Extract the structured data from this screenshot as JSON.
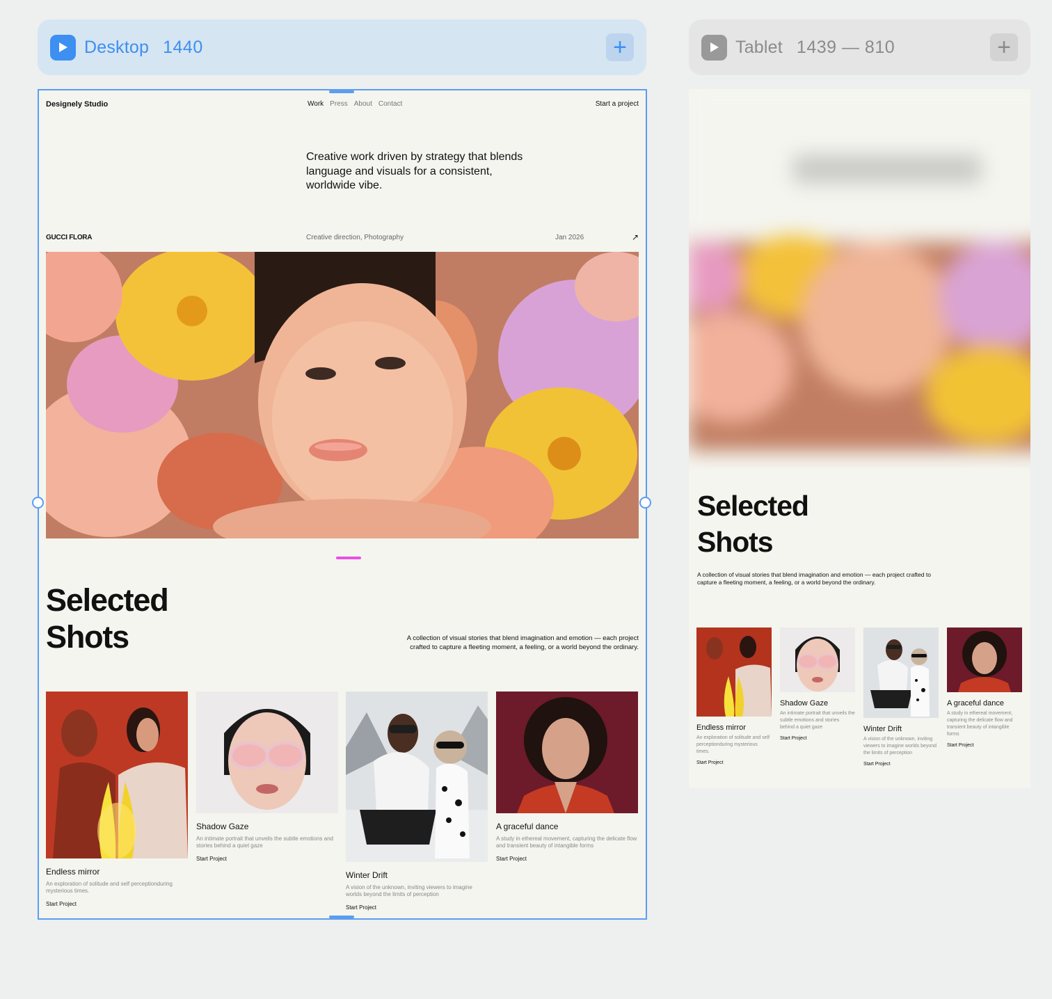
{
  "breakpoints": {
    "desktop": {
      "name": "Desktop",
      "size": "1440",
      "add_label": "+"
    },
    "tablet": {
      "name": "Tablet",
      "size": "1439 — 810",
      "add_label": "+"
    }
  },
  "site": {
    "brand": "Designely Studio",
    "nav": [
      "Work",
      "Press",
      "About",
      "Contact"
    ],
    "cta": "Start a project",
    "hero_copy": "Creative work driven by strategy that blends language and visuals for a consistent, worldwide vibe.",
    "featured": {
      "title": "GUCCI FLORA",
      "role": "Creative direction, Photography",
      "date": "Jan 2026",
      "arrow": "↗"
    },
    "selected": {
      "title_line1": "Selected",
      "title_line2": "Shots",
      "description": "A collection of visual stories that blend imagination and emotion — each project crafted to capture a fleeting moment, a feeling, or a world beyond the ordinary."
    },
    "cards": [
      {
        "title": "Endless mirror",
        "desc": "An exploration of solitude and self perceptionduring mysterious times.",
        "link": "Start Project"
      },
      {
        "title": "Shadow Gaze",
        "desc": "An intimate portrait that unveils the subtle emotions and stories behind a quiet gaze",
        "link": "Start Project"
      },
      {
        "title": "Winter Drift",
        "desc": "A vision of the unknown, inviting viewers to imagine worlds beyond the limits of perception",
        "link": "Start Project"
      },
      {
        "title": "A graceful dance",
        "desc": "A study in ethereal movement, capturing the delicate flow and transient beauty of intangible forms",
        "link": "Start Project"
      }
    ]
  },
  "colors": {
    "accent": "#3d8ff1",
    "frame_bg": "#f4f5ef",
    "canvas_bg": "#eeefef",
    "marker": "#e94fe3"
  }
}
